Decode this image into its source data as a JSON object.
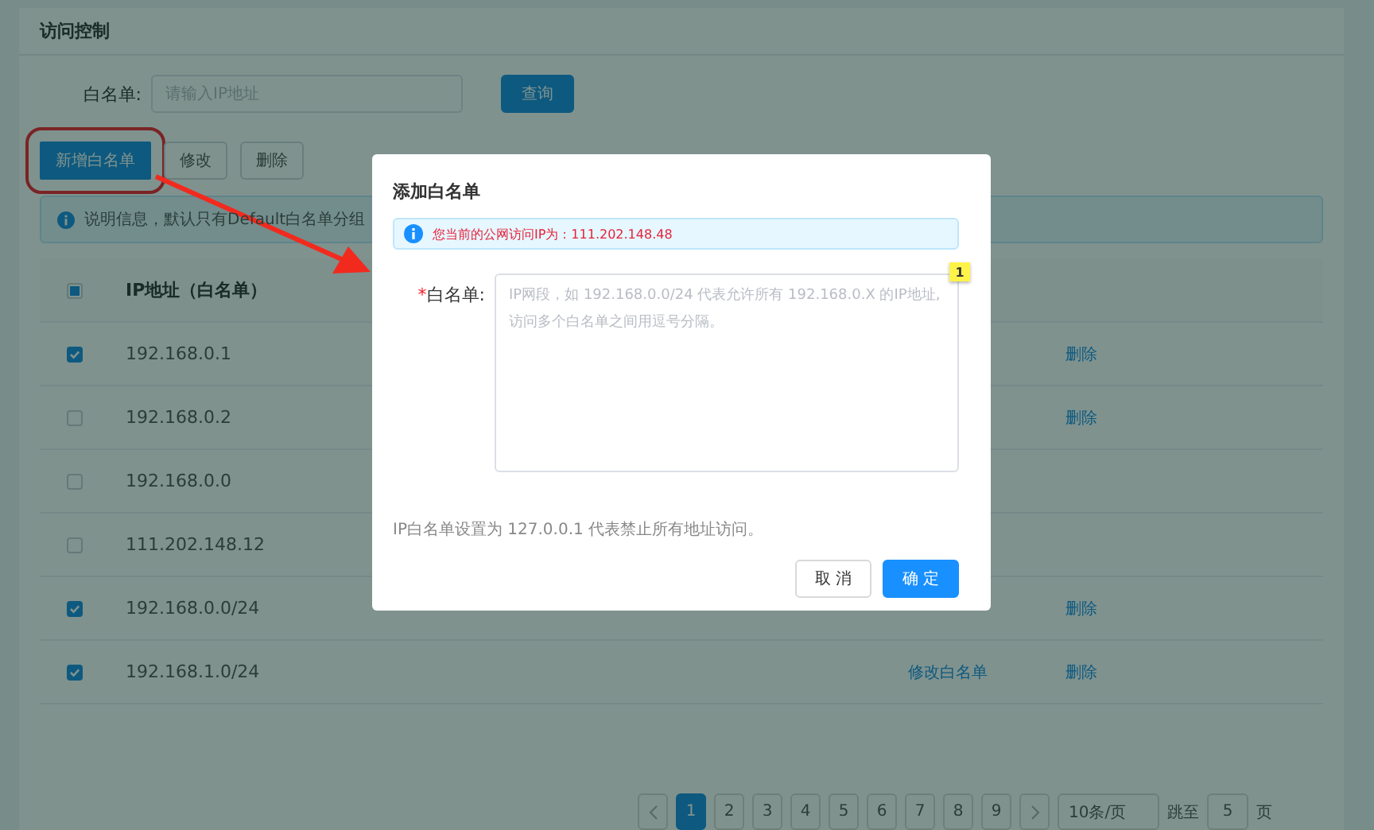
{
  "page": {
    "title": "访问控制"
  },
  "search": {
    "label": "白名单:",
    "placeholder": "请输入IP地址",
    "button": "查询"
  },
  "toolbar": [
    {
      "label": "新增白名单",
      "kind": "primary",
      "highlighted": true
    },
    {
      "label": "修改",
      "kind": "default",
      "highlighted": false
    },
    {
      "label": "删除",
      "kind": "default",
      "highlighted": false
    }
  ],
  "info": "说明信息，默认只有Default白名单分组",
  "table": {
    "select_all": {
      "indeterminate": true
    },
    "columns": [
      "IP地址（白名单）"
    ],
    "rows": [
      {
        "ip": "192.168.0.1",
        "checked": true,
        "edit": "",
        "delete": "删除"
      },
      {
        "ip": "192.168.0.2",
        "checked": false,
        "edit": "",
        "delete": "删除"
      },
      {
        "ip": "192.168.0.0",
        "checked": false,
        "edit": "",
        "delete": ""
      },
      {
        "ip": "111.202.148.12",
        "checked": false,
        "edit": "",
        "delete": ""
      },
      {
        "ip": "192.168.0.0/24",
        "checked": true,
        "edit": "",
        "delete": "删除"
      },
      {
        "ip": "192.168.1.0/24",
        "checked": true,
        "edit": "修改白名单",
        "delete": "删除"
      }
    ]
  },
  "pagination": {
    "pages": [
      {
        "label": "1",
        "selected": true
      },
      {
        "label": "2",
        "selected": false
      },
      {
        "label": "3",
        "selected": false
      },
      {
        "label": "4",
        "selected": false
      },
      {
        "label": "5",
        "selected": false
      },
      {
        "label": "6",
        "selected": false
      },
      {
        "label": "7",
        "selected": false
      },
      {
        "label": "8",
        "selected": false
      },
      {
        "label": "9",
        "selected": false
      }
    ],
    "page_size": "10条/页",
    "jump_label": "跳至",
    "jump_value": "5",
    "jump_unit": "页"
  },
  "dialog": {
    "title": "添加白名单",
    "alert": "您当前的公网访问IP为：111.202.148.48",
    "required_mark": "*",
    "field_label": "白名单:",
    "placeholder": "IP网段，如 192.168.0.0/24 代表允许所有 192.168.0.X 的IP地址,访问多个白名单之间用逗号分隔。",
    "note": "IP白名单设置为 127.0.0.1 代表禁止所有地址访问。",
    "cancel": "取 消",
    "ok": "确 定",
    "badge": "1"
  }
}
